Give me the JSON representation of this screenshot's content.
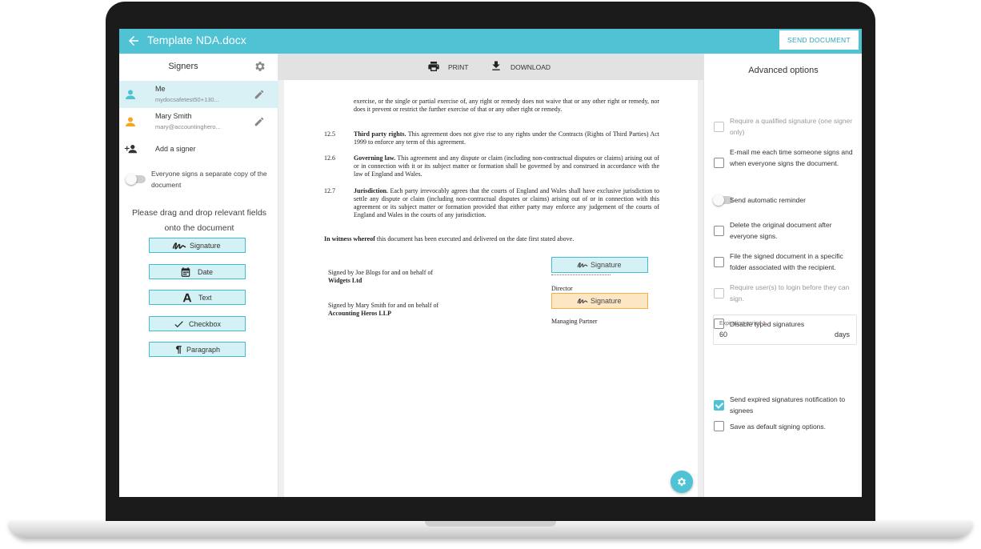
{
  "header": {
    "title": "Template NDA.docx",
    "send_button": "SEND DOCUMENT"
  },
  "signers": {
    "title": "Signers",
    "list": [
      {
        "name": "Me",
        "email": "mydocsafetest50+130..."
      },
      {
        "name": "Mary Smith",
        "email": "mary@accountinghero..."
      }
    ],
    "add_label": "Add a signer",
    "separate_copy_label": "Everyone signs a separate copy of the document",
    "drag_hint": "Please drag and drop relevant fields onto the document",
    "fields": [
      {
        "label": "Signature",
        "icon": "signature-icon"
      },
      {
        "label": "Date",
        "icon": "calendar-icon"
      },
      {
        "label": "Text",
        "icon": "text-icon"
      },
      {
        "label": "Checkbox",
        "icon": "check-icon"
      },
      {
        "label": "Paragraph",
        "icon": "paragraph-icon"
      }
    ]
  },
  "toolbar": {
    "print": "PRINT",
    "download": "DOWNLOAD"
  },
  "document": {
    "intro": "exercise, or the single or partial exercise of, any right or remedy does not waive that or any other right or remedy, nor does it prevent or restrict the further exercise of that or any other right or remedy.",
    "clauses": [
      {
        "num": "12.5",
        "heading": "Third party rights.",
        "text": " This agreement does not give rise to any rights under the Contracts (Rights of Third Parties) Act 1999 to enforce any term of this agreement."
      },
      {
        "num": "12.6",
        "heading": "Governing law.",
        "text": " This agreement and any dispute or claim (including non-contractual disputes or claims) arising out of or in connection with it or its subject matter or formation shall be governed by and construed in accordance with the law of England and Wales."
      },
      {
        "num": "12.7",
        "heading": "Jurisdiction.",
        "text": " Each party irrevocably agrees that the courts of England and Wales shall have exclusive jurisdiction to settle any dispute or claim (including non-contractual disputes or claims) arising out of or in connection with this agreement or its subject matter or formation provided that either party may enforce any judgement of the courts of England and Wales in the courts of any jurisdiction."
      }
    ],
    "witness_bold": "In witness whereof",
    "witness_text": " this document has been executed and delivered on the date first stated above.",
    "signed_1_prefix": "Signed by Joe Blogs for and on behalf of ",
    "signed_1_company": "Widgets Ltd",
    "signed_2_prefix": "Signed by Mary Smith for and on behalf of ",
    "signed_2_company": "Accounting Heros LLP",
    "role_1": "Director",
    "role_2": "Managing Partner",
    "sig_field_label": "Signature"
  },
  "advanced": {
    "title": "Advanced options",
    "options": [
      {
        "label": "Require a qualified signature (one signer only)",
        "checked": false,
        "disabled": true
      },
      {
        "label": "E-mail me each time someone signs and when everyone signs the document.",
        "checked": false,
        "disabled": false
      },
      {
        "label": "Send automatic reminder",
        "type": "toggle",
        "checked": false
      },
      {
        "label": "Delete the original document after everyone signs.",
        "checked": false,
        "disabled": false
      },
      {
        "label": "File the signed document in a specific folder associated with the recipient.",
        "checked": false,
        "disabled": false
      },
      {
        "label": "Require user(s) to login before they can sign.",
        "checked": false,
        "disabled": true
      },
      {
        "label": "Disable typed signatures",
        "checked": false,
        "disabled": false
      },
      {
        "label": "Send expired signatures notification to signees",
        "checked": true,
        "disabled": false
      },
      {
        "label": "Save as default signing options.",
        "checked": false,
        "disabled": false
      }
    ],
    "expiration": {
      "label": "Expiration period",
      "required_mark": "*",
      "value": "60",
      "unit": "days"
    }
  },
  "colors": {
    "accent": "#4fc3d4",
    "field_blue": "#d4f1f6",
    "field_orange": "#fde6c3"
  }
}
